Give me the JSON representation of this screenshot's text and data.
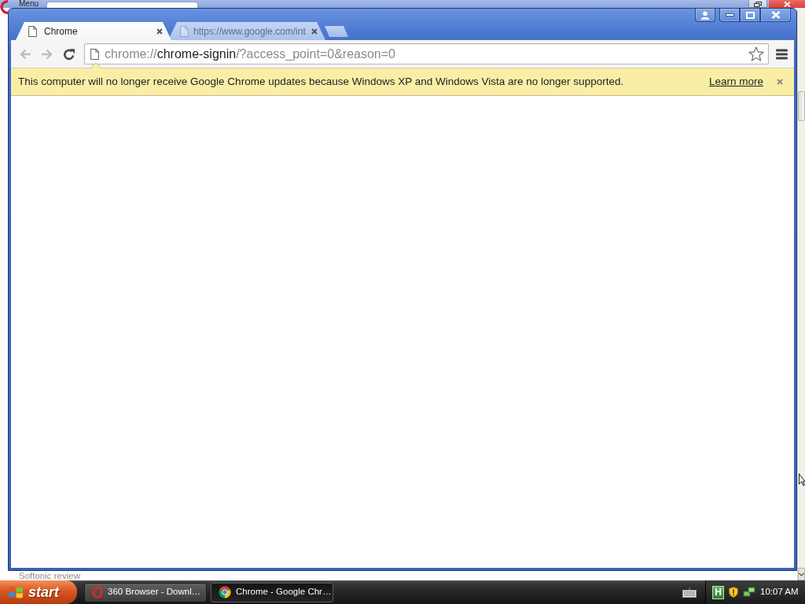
{
  "background_window": {
    "menu_label": "Menu",
    "page_text": "Softonic review"
  },
  "browser": {
    "tabs": [
      {
        "title": "Chrome",
        "selected": true
      },
      {
        "title": "https://www.google.com/int",
        "selected": false
      }
    ],
    "toolbar": {
      "buttons": [
        {
          "kind": "back",
          "disabled": true
        },
        {
          "kind": "forward",
          "disabled": true
        },
        {
          "kind": "reload",
          "disabled": false
        }
      ],
      "url": {
        "scheme": "chrome://",
        "host": "chrome-signin",
        "path": "/?access_point=0&reason=0"
      }
    },
    "infobar": {
      "message": "This computer will no longer receive Google Chrome updates because Windows XP and Windows Vista are no longer supported.",
      "link": "Learn more"
    }
  },
  "taskbar": {
    "start": "start",
    "items": [
      {
        "label": "360 Browser - Downl…",
        "kind": "opera",
        "selected": false
      },
      {
        "label": "Chrome - Google Chr…",
        "kind": "chrome",
        "selected": true
      }
    ],
    "tray_badge": "H",
    "clock": "10:07 AM"
  }
}
